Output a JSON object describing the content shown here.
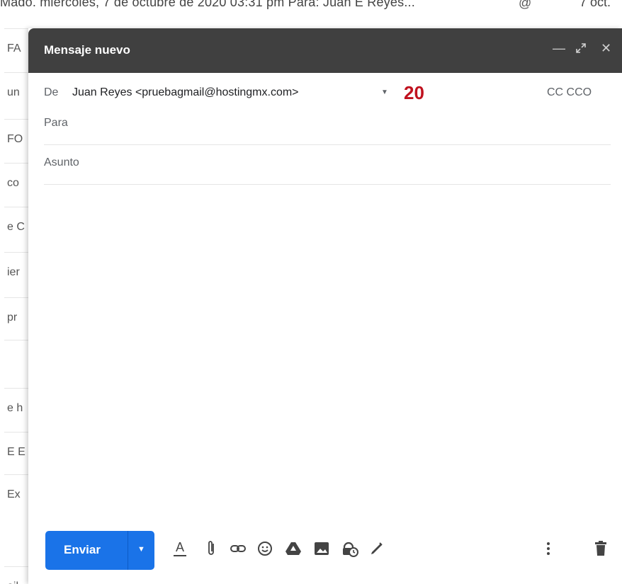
{
  "background": {
    "top_line": "Mado. miercoles, 7 de octubre de 2020 03:31 pm Para: Juan E Reyes...",
    "top_date": "7 oct.",
    "left_fragments": [
      "FA",
      "un",
      "FO",
      "co",
      "e C",
      "ier",
      "pr",
      "",
      "e h",
      "E E",
      "Ex",
      "ail"
    ]
  },
  "compose": {
    "title": "Mensaje nuevo",
    "from_label": "De",
    "from_value": "Juan Reyes <pruebagmail@hostingmx.com>",
    "annotation": "20",
    "cc_label": "CC CCO",
    "to_label": "Para",
    "subject_label": "Asunto",
    "send_label": "Enviar"
  },
  "icons": {
    "window": [
      "minimize-icon",
      "expand-icon",
      "close-icon"
    ],
    "toolbar": [
      "format-text-icon",
      "attach-icon",
      "link-icon",
      "emoji-icon",
      "drive-icon",
      "photo-icon",
      "confidential-icon",
      "signature-icon",
      "more-options-icon",
      "trash-icon"
    ]
  },
  "colors": {
    "header_bg": "#404040",
    "send_button": "#1a73e8",
    "annotation": "#c0121f"
  }
}
